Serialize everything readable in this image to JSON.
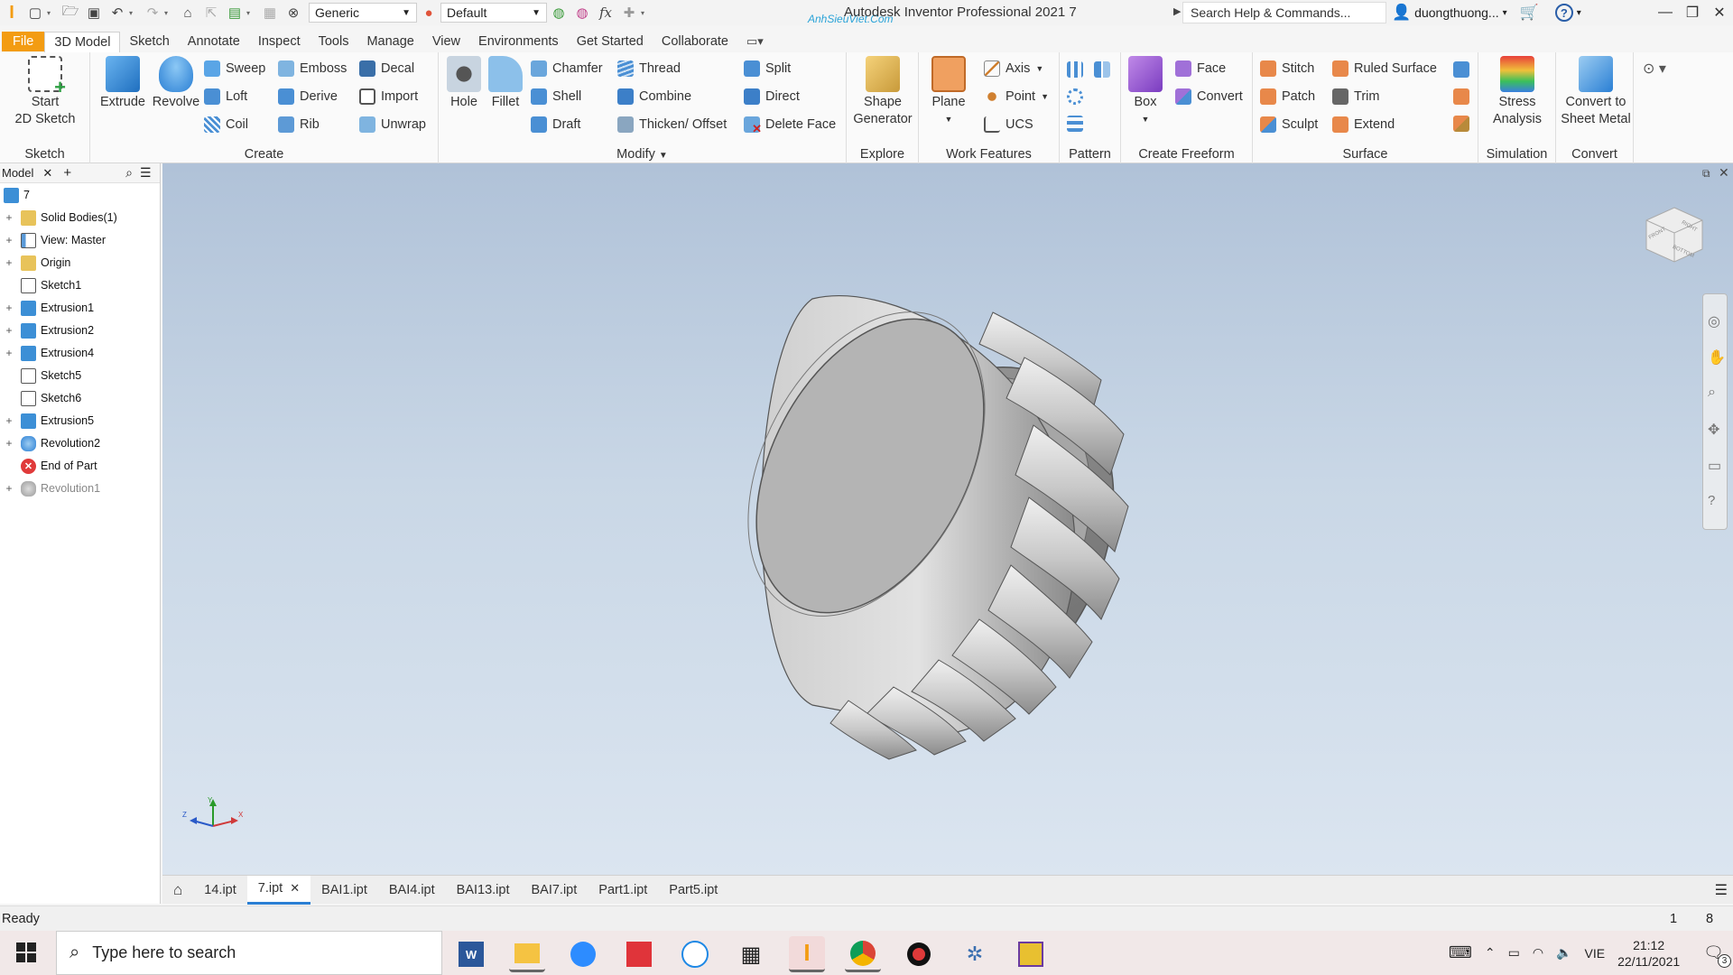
{
  "titlebar": {
    "app_title": "Autodesk Inventor Professional 2021   7",
    "watermark": "AnhSieuViet.Com",
    "material_value": "Generic",
    "appearance_value": "Default",
    "search_placeholder": "Search Help & Commands...",
    "user_name": "duongthuong...",
    "help_label": "?"
  },
  "menu": {
    "tabs": [
      "File",
      "3D Model",
      "Sketch",
      "Annotate",
      "Inspect",
      "Tools",
      "Manage",
      "View",
      "Environments",
      "Get Started",
      "Collaborate"
    ]
  },
  "ribbon": {
    "sketch": {
      "label": "Sketch",
      "start_sketch": "Start\n2D Sketch"
    },
    "create": {
      "label": "Create",
      "extrude": "Extrude",
      "revolve": "Revolve",
      "sweep": "Sweep",
      "loft": "Loft",
      "coil": "Coil",
      "emboss": "Emboss",
      "derive": "Derive",
      "rib": "Rib",
      "decal": "Decal",
      "import": "Import",
      "unwrap": "Unwrap"
    },
    "modify": {
      "label": "Modify",
      "hole": "Hole",
      "fillet": "Fillet",
      "chamfer": "Chamfer",
      "shell": "Shell",
      "draft": "Draft",
      "thread": "Thread",
      "combine": "Combine",
      "thicken": "Thicken/ Offset",
      "split": "Split",
      "direct": "Direct",
      "delete_face": "Delete Face"
    },
    "explore": {
      "label": "Explore",
      "shape_generator": "Shape\nGenerator"
    },
    "work_features": {
      "label": "Work Features",
      "plane": "Plane",
      "axis": "Axis",
      "point": "Point",
      "ucs": "UCS"
    },
    "pattern": {
      "label": "Pattern"
    },
    "freeform": {
      "label": "Create Freeform",
      "box": "Box",
      "face": "Face",
      "convert": "Convert"
    },
    "surface": {
      "label": "Surface",
      "stitch": "Stitch",
      "patch": "Patch",
      "sculpt": "Sculpt",
      "ruled_surface": "Ruled Surface",
      "trim": "Trim",
      "extend": "Extend"
    },
    "simulation": {
      "label": "Simulation",
      "stress": "Stress\nAnalysis"
    },
    "convert": {
      "label": "Convert",
      "sheet_metal": "Convert to\nSheet Metal"
    }
  },
  "browser": {
    "tab_label": "Model",
    "root": "7",
    "items": [
      {
        "label": "Solid Bodies(1)",
        "icon": "folder-icon",
        "expandable": true
      },
      {
        "label": "View: Master",
        "icon": "view-icon",
        "expandable": true
      },
      {
        "label": "Origin",
        "icon": "folder-icon",
        "expandable": true
      },
      {
        "label": "Sketch1",
        "icon": "sketch-icon",
        "expandable": false
      },
      {
        "label": "Extrusion1",
        "icon": "extrusion-icon",
        "expandable": true
      },
      {
        "label": "Extrusion2",
        "icon": "extrusion-icon",
        "expandable": true
      },
      {
        "label": "Extrusion4",
        "icon": "extrusion-icon",
        "expandable": true
      },
      {
        "label": "Sketch5",
        "icon": "sketch-icon",
        "expandable": false
      },
      {
        "label": "Sketch6",
        "icon": "sketch-icon",
        "expandable": false
      },
      {
        "label": "Extrusion5",
        "icon": "extrusion-icon",
        "expandable": true
      },
      {
        "label": "Revolution2",
        "icon": "revolution-icon",
        "expandable": true
      },
      {
        "label": "End of Part",
        "icon": "end-of-part-icon",
        "expandable": false
      },
      {
        "label": "Revolution1",
        "icon": "revolution-icon",
        "expandable": true,
        "suppressed": true
      }
    ]
  },
  "viewcube": {
    "front": "FRONT",
    "right": "RIGHT",
    "bottom": "BOTTOM"
  },
  "triad": {
    "x": "X",
    "y": "Y",
    "z": "Z"
  },
  "doc_tabs": [
    "14.ipt",
    "7.ipt",
    "BAI1.ipt",
    "BAI4.ipt",
    "BAI13.ipt",
    "BAI7.ipt",
    "Part1.ipt",
    "Part5.ipt"
  ],
  "active_doc": "7.ipt",
  "status": {
    "text": "Ready",
    "count1": "1",
    "count2": "8"
  },
  "taskbar": {
    "search_placeholder": "Type here to search",
    "language": "VIE",
    "time": "21:12",
    "date": "22/11/2021",
    "notifications": "3"
  },
  "colors": {
    "file_tab": "#f39c12",
    "accent": "#2a7fd4",
    "extrusion_blue": "#3c8fd6",
    "folder_yellow": "#e8c35a"
  }
}
